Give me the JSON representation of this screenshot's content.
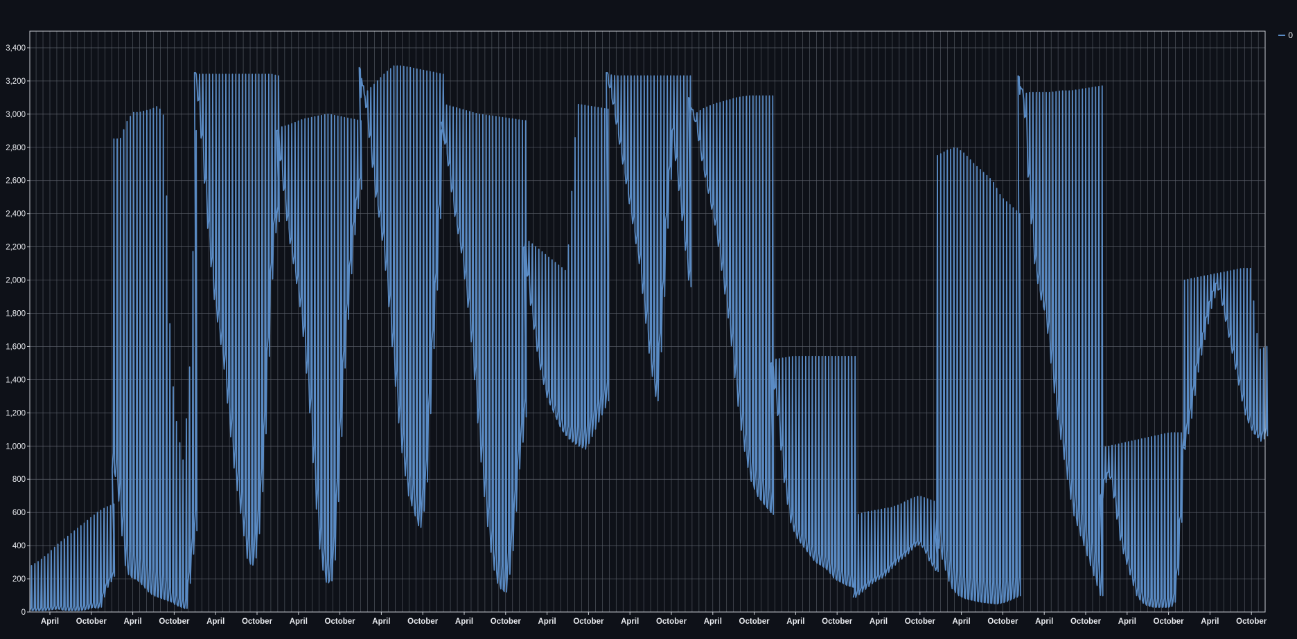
{
  "chart_data": {
    "type": "line",
    "title": "",
    "xlabel": "",
    "ylabel": "",
    "ylim": [
      0,
      3500
    ],
    "yticks": [
      0,
      200,
      400,
      600,
      800,
      1000,
      1200,
      1400,
      1600,
      1800,
      2000,
      2200,
      2400,
      2600,
      2800,
      3000,
      3200,
      3400
    ],
    "ytick_labels": [
      "0",
      "200",
      "400",
      "600",
      "800",
      "1,000",
      "1,200",
      "1,400",
      "1,600",
      "1,800",
      "2,000",
      "2,200",
      "2,400",
      "2,600",
      "2,800",
      "3,000",
      "3,200",
      "3,400"
    ],
    "xticks": [
      "April",
      "October",
      "April",
      "October",
      "April",
      "October",
      "April",
      "October",
      "April",
      "October",
      "April",
      "October",
      "April",
      "October",
      "April",
      "October",
      "April",
      "October",
      "April",
      "October",
      "April",
      "October",
      "April",
      "October",
      "April",
      "October",
      "April",
      "October",
      "April",
      "October"
    ],
    "grid": true,
    "line_color": "#5a8bc4",
    "background": "#0e1118",
    "legend_position": "top-right",
    "series": [
      {
        "name": "0",
        "segments": [
          {
            "low": [
              10,
              10,
              10,
              15,
              20,
              10,
              10,
              10,
              15,
              30,
              20,
              150,
              220
            ],
            "high": [
              280,
              310,
              350,
              400,
              440,
              480,
              520,
              560,
              600,
              630,
              650
            ]
          },
          {
            "low": [
              860,
              800,
              500,
              250,
              210,
              200,
              180,
              150,
              120,
              100,
              90,
              80,
              70,
              60,
              40,
              30,
              20,
              300,
              500
            ],
            "high": [
              2850,
              2850,
              2950,
              3010,
              3010,
              3020,
              3030,
              3050,
              2980,
              1500,
              1100,
              900,
              1500,
              2900
            ]
          },
          {
            "low": [
              3250,
              3000,
              2600,
              2200,
              1900,
              1700,
              1500,
              1200,
              900,
              700,
              500,
              300,
              280,
              500,
              900,
              1600,
              2300,
              2400
            ],
            "high": [
              3240,
              3240,
              3240,
              3240,
              3240,
              3240,
              3240,
              3240,
              3240,
              3240,
              3240,
              3240,
              3230
            ]
          },
          {
            "low": [
              2900,
              2600,
              2300,
              2100,
              1900,
              1600,
              1200,
              700,
              300,
              180,
              200,
              800,
              1500,
              2000,
              2400,
              2600
            ],
            "high": [
              2920,
              2930,
              2950,
              2970,
              2980,
              2990,
              3000,
              2990,
              2980,
              2970,
              2960
            ]
          },
          {
            "low": [
              3280,
              3100,
              2800,
              2500,
              2300,
              2000,
              1600,
              1200,
              900,
              700,
              600,
              500,
              800,
              1500,
              2100,
              2900
            ],
            "high": [
              3100,
              3150,
              3200,
              3250,
              3290,
              3290,
              3280,
              3270,
              3260,
              3250,
              3240
            ]
          },
          {
            "low": [
              2950,
              2700,
              2400,
              2200,
              1900,
              1500,
              1000,
              600,
              300,
              150,
              120,
              400,
              900,
              1200
            ],
            "high": [
              3060,
              3040,
              3020,
              3000,
              2990,
              2980,
              2970,
              2960
            ]
          },
          {
            "low": [
              2200,
              1800,
              1500,
              1300,
              1200,
              1100,
              1050,
              1020,
              1000,
              1100,
              1200,
              1300
            ],
            "high": [
              2250,
              2200,
              2150,
              2100,
              2050,
              3060,
              3050,
              3040,
              3030
            ]
          },
          {
            "low": [
              3250,
              3100,
              2900,
              2700,
              2500,
              2300,
              2100,
              1800,
              1500,
              1300,
              1800,
              2500,
              2900,
              2600,
              2300,
              2000
            ],
            "high": [
              3240,
              3230,
              3230,
              3230,
              3230,
              3230,
              3230,
              3230,
              3230,
              3230,
              3230
            ]
          },
          {
            "low": [
              3100,
              2950,
              2700,
              2500,
              2300,
              2000,
              1700,
              1300,
              1000,
              800,
              700,
              650,
              600
            ],
            "high": [
              2980,
              3030,
              3060,
              3080,
              3100,
              3110,
              3110,
              3110
            ]
          },
          {
            "low": [
              1500,
              1200,
              800,
              550,
              450,
              400,
              350,
              300,
              280,
              250,
              200,
              180,
              160,
              150
            ],
            "high": [
              1520,
              1530,
              1540,
              1540,
              1540,
              1540,
              1540,
              1540,
              1540
            ]
          },
          {
            "low": [
              90,
              120,
              150,
              180,
              200,
              220,
              260,
              300,
              330,
              360,
              400,
              420,
              380,
              300,
              250
            ],
            "high": [
              580,
              600,
              610,
              620,
              630,
              650,
              680,
              700,
              680,
              660
            ]
          },
          {
            "low": [
              450,
              300,
              150,
              100,
              80,
              70,
              60,
              55,
              50,
              60,
              80,
              100
            ],
            "high": [
              2750,
              2780,
              2800,
              2760,
              2700,
              2650,
              2600,
              2500,
              2450,
              2400
            ]
          },
          {
            "low": [
              3230,
              3100,
              2500,
              2100,
              1900,
              1800,
              1500,
              1200,
              1000,
              800,
              600,
              500,
              400,
              300,
              200,
              100
            ],
            "high": [
              3120,
              3130,
              3130,
              3130,
              3140,
              3140,
              3150,
              3160,
              3170
            ]
          },
          {
            "low": [
              700,
              850,
              800,
              600,
              400,
              300,
              200,
              100,
              60,
              40,
              30,
              30,
              30,
              30,
              40,
              300,
              1000
            ],
            "high": [
              990,
              1000,
              1010,
              1020,
              1030,
              1040,
              1050,
              1060,
              1070,
              1080,
              1080,
              1080
            ]
          },
          {
            "low": [
              1000,
              1200,
              1500,
              1700,
              1900,
              2000,
              1800,
              1600,
              1400,
              1200,
              1100,
              1050,
              1080
            ],
            "high": [
              2000,
              2010,
              2020,
              2030,
              2040,
              2050,
              2060,
              2070,
              2070,
              1580,
              1600
            ]
          }
        ]
      }
    ]
  }
}
